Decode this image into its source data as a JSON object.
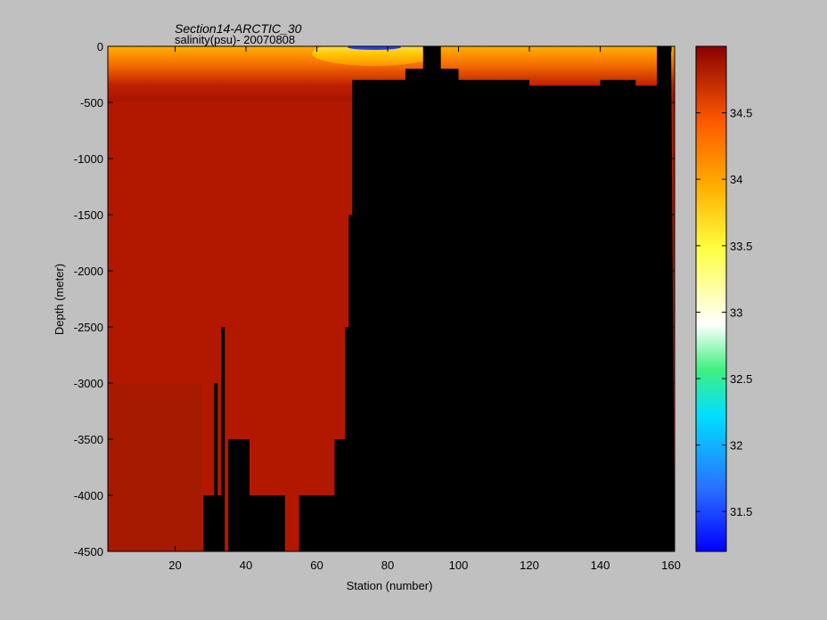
{
  "chart_data": {
    "type": "heatmap",
    "title": "Section14-ARCTIC_30",
    "subtitle": "salinity(psu)- 20070808",
    "xlabel": "Station (number)",
    "ylabel": "Depth (meter)",
    "xlim": [
      1,
      161
    ],
    "ylim": [
      -4500,
      0
    ],
    "xticks": [
      20,
      40,
      60,
      80,
      100,
      120,
      140,
      160
    ],
    "yticks": [
      0,
      -500,
      -1000,
      -1500,
      -2000,
      -2500,
      -3000,
      -3500,
      -4000,
      -4500
    ],
    "colorbar": {
      "range": [
        31.2,
        35.0
      ],
      "ticks": [
        31.5,
        32,
        32.5,
        33,
        33.5,
        34,
        34.5
      ],
      "colormap": "jet"
    },
    "no_data_color": "#000000",
    "surface_layer": {
      "depth_range": [
        0,
        -350
      ],
      "salinity_range": [
        33.0,
        34.9
      ],
      "freshest_near_station": 80
    },
    "deep_salinity": 34.9,
    "bottom_depth_profile": {
      "stations": [
        1,
        27,
        28,
        30,
        31,
        32,
        33,
        34,
        35,
        40,
        41,
        50,
        51,
        54,
        55,
        64,
        65,
        67,
        68,
        69,
        70,
        85,
        90,
        95,
        100,
        110,
        120,
        140,
        150,
        155,
        156,
        160
      ],
      "depth": [
        -4500,
        -4500,
        -4000,
        -4000,
        -3000,
        -4000,
        -2500,
        -4500,
        -3500,
        -3500,
        -4000,
        -4000,
        -4500,
        -4500,
        -4000,
        -4000,
        -3500,
        -3500,
        -2500,
        -1500,
        -300,
        -200,
        0,
        -200,
        -300,
        -300,
        -350,
        -300,
        -350,
        -350,
        0,
        0
      ]
    }
  }
}
